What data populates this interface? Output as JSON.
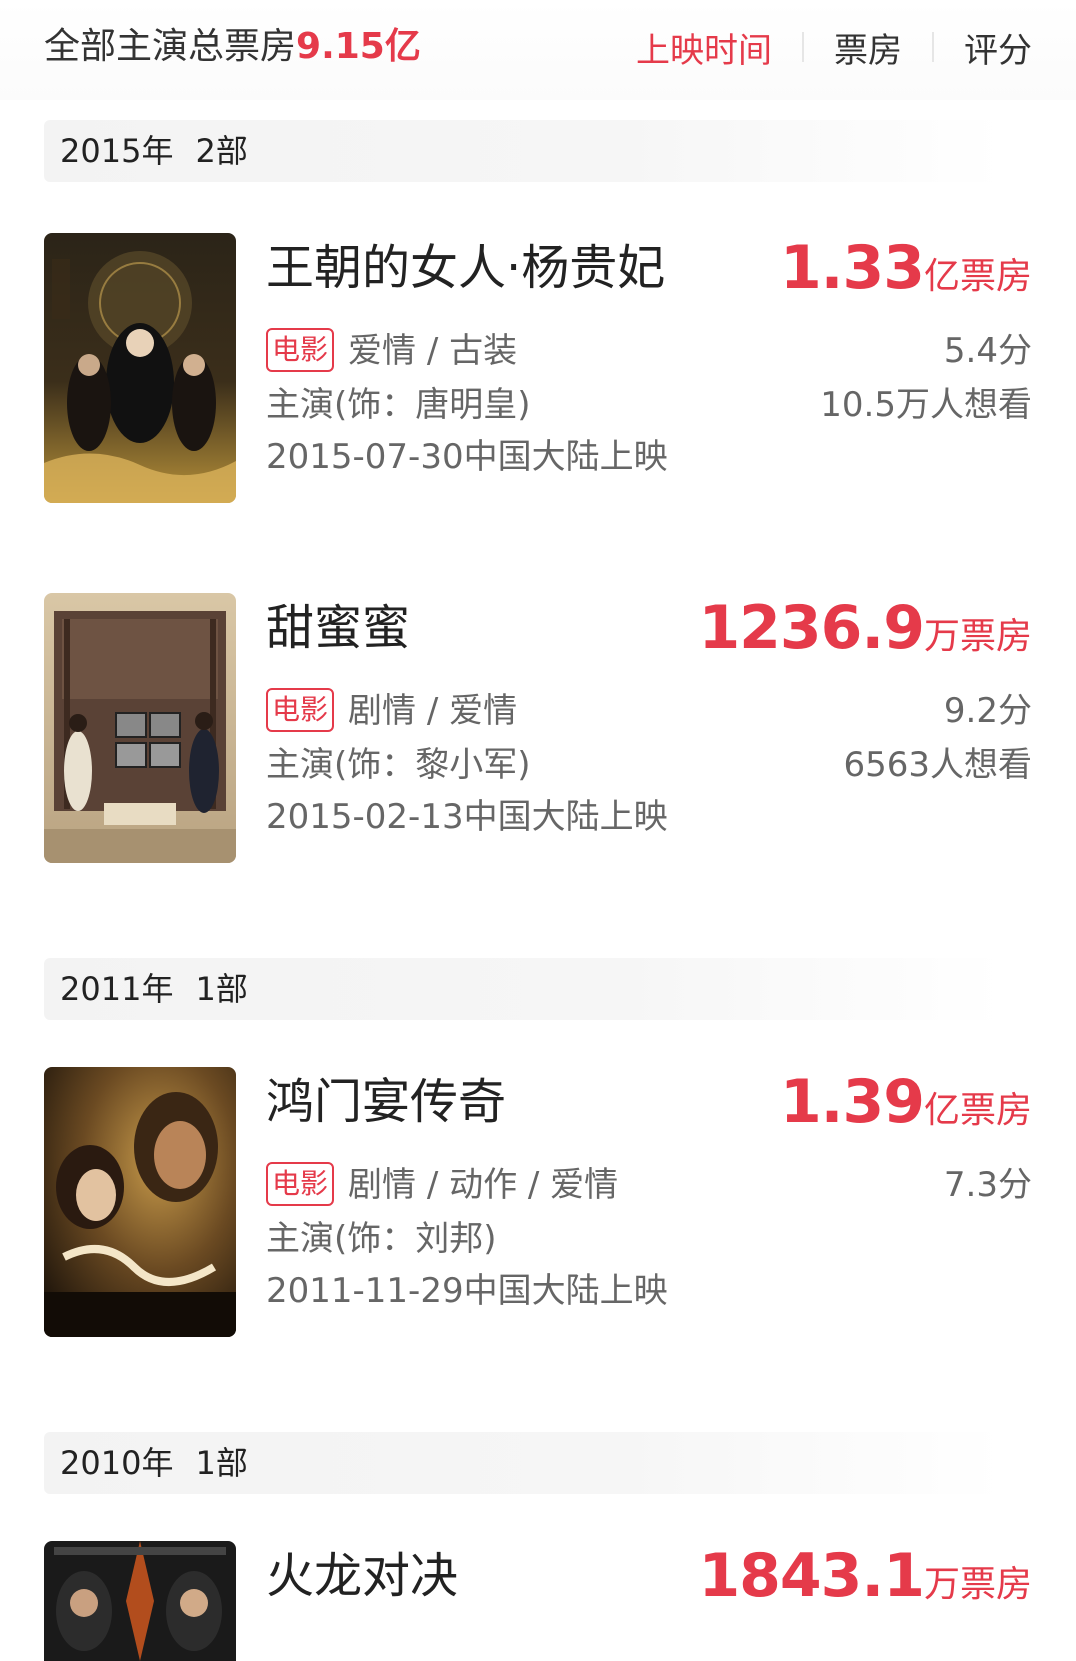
{
  "header": {
    "summary_label": "全部主演总票房",
    "summary_total": "9.15亿",
    "sort_options": [
      "上映时间",
      "票房",
      "评分"
    ]
  },
  "groups": [
    {
      "year": "2015年",
      "count": "2部"
    },
    {
      "year": "2011年",
      "count": "1部"
    },
    {
      "year": "2010年",
      "count": "1部"
    }
  ],
  "movies": [
    {
      "title": "王朝的女人·杨贵妃",
      "box_num": "1.33",
      "box_unit": "亿票房",
      "tag": "电影",
      "genres": "爱情 / 古装",
      "role": "主演(饰：唐明皇)",
      "release": "2015-07-30中国大陆上映",
      "score": "5.4分",
      "wish": "10.5万人想看"
    },
    {
      "title": "甜蜜蜜",
      "box_num": "1236.9",
      "box_unit": "万票房",
      "tag": "电影",
      "genres": "剧情 / 爱情",
      "role": "主演(饰：黎小军)",
      "release": "2015-02-13中国大陆上映",
      "score": "9.2分",
      "wish": "6563人想看"
    },
    {
      "title": "鸿门宴传奇",
      "box_num": "1.39",
      "box_unit": "亿票房",
      "tag": "电影",
      "genres": "剧情 / 动作 / 爱情",
      "role": "主演(饰：刘邦)",
      "release": "2011-11-29中国大陆上映",
      "score": "7.3分"
    },
    {
      "title": "火龙对决",
      "box_num": "1843.1",
      "box_unit": "万票房"
    }
  ],
  "colors": {
    "accent": "#e53a4a"
  }
}
